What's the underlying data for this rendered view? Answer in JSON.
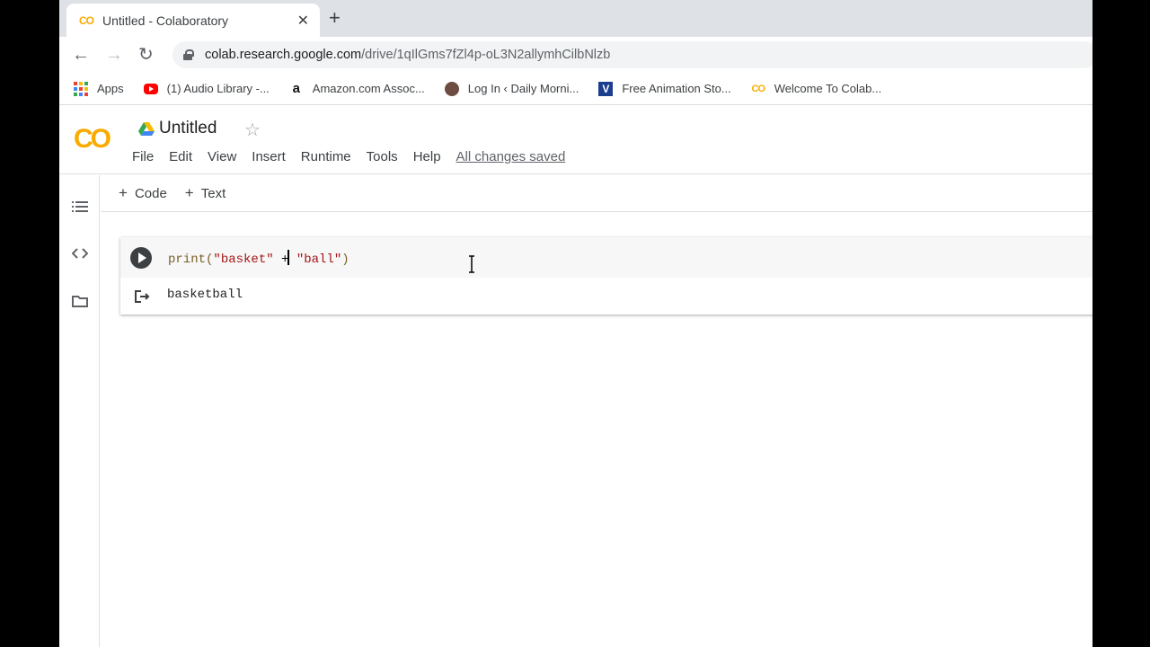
{
  "browser": {
    "tab": {
      "title": "Untitled - Colaboratory",
      "favicon": "colab-favicon"
    },
    "address": {
      "host": "colab.research.google.com",
      "path": "/drive/1qIlGms7fZl4p-oL3N2allymhCilbNlzb"
    },
    "bookmarks": [
      {
        "label": "Apps",
        "icon": "apps-grid-icon"
      },
      {
        "label": "(1) Audio Library -...",
        "icon": "youtube-icon"
      },
      {
        "label": "Amazon.com Assoc...",
        "icon": "amazon-icon"
      },
      {
        "label": "Log In ‹ Daily Morni...",
        "icon": "daily-morning-icon"
      },
      {
        "label": "Free Animation Sto...",
        "icon": "v-icon"
      },
      {
        "label": "Welcome To Colab...",
        "icon": "colab-icon"
      }
    ]
  },
  "colab": {
    "logo": "CO",
    "title": "Untitled",
    "menu": [
      "File",
      "Edit",
      "View",
      "Insert",
      "Runtime",
      "Tools",
      "Help"
    ],
    "save_status": "All changes saved",
    "add_code": "Code",
    "add_text": "Text",
    "cell": {
      "code_fn": "print(",
      "code_str1": "\"basket\"",
      "code_op": " +",
      "code_str2": " \"ball\"",
      "code_close": ")",
      "output": "basketball"
    }
  },
  "colors": {
    "accent": "#f9ab00",
    "background": "#ffffff",
    "rail_border": "#e0e0e0"
  }
}
